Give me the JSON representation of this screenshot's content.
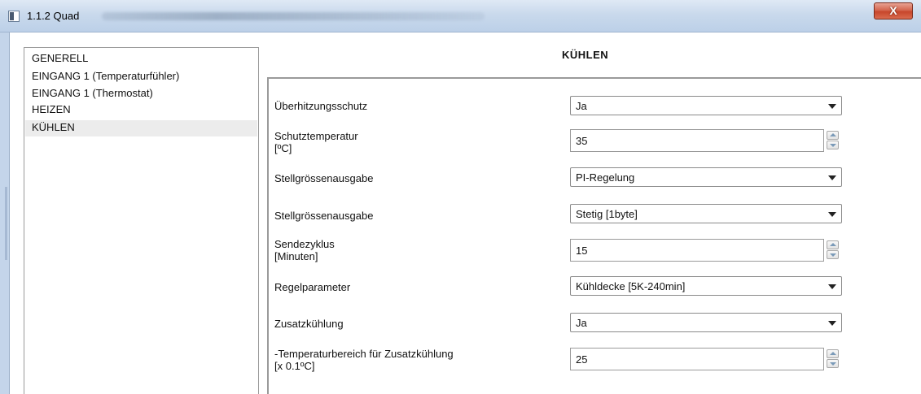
{
  "window": {
    "title": "1.1.2 Quad",
    "close_label": "X"
  },
  "tree": {
    "items": [
      {
        "label": "GENERELL"
      },
      {
        "label": "EINGANG 1 (Temperaturfühler)"
      },
      {
        "label": "EINGANG 1 (Thermostat)"
      },
      {
        "label": "HEIZEN"
      },
      {
        "label": "KÜHLEN",
        "selected": true
      }
    ]
  },
  "section": {
    "title": "KÜHLEN"
  },
  "params": [
    {
      "label_line1": "Überhitzungsschutz",
      "label_line2": "",
      "control": "dropdown",
      "value": "Ja"
    },
    {
      "label_line1": "Schutztemperatur",
      "label_line2": "[ºC]",
      "control": "spinner",
      "value": "35"
    },
    {
      "label_line1": "Stellgrössenausgabe",
      "label_line2": "",
      "control": "dropdown",
      "value": "PI-Regelung"
    },
    {
      "label_line1": "Stellgrössenausgabe",
      "label_line2": "",
      "control": "dropdown",
      "value": "Stetig [1byte]"
    },
    {
      "label_line1": "Sendezyklus",
      "label_line2": "[Minuten]",
      "control": "spinner",
      "value": "15"
    },
    {
      "label_line1": "Regelparameter",
      "label_line2": "",
      "control": "dropdown",
      "value": "Kühldecke [5K-240min]"
    },
    {
      "label_line1": "Zusatzkühlung",
      "label_line2": "",
      "control": "dropdown",
      "value": "Ja"
    },
    {
      "label_line1": "-Temperaturbereich für Zusatzkühlung",
      "label_line2": "[x 0.1ºC]",
      "control": "spinner",
      "value": "25"
    }
  ]
}
